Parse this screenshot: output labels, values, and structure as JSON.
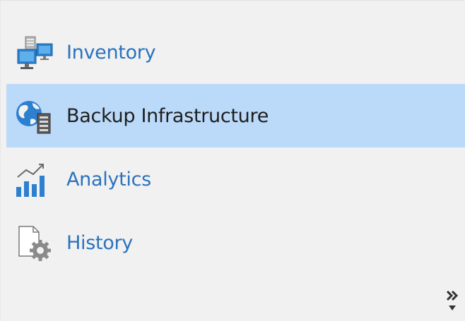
{
  "nav": {
    "items": [
      {
        "label": "Inventory",
        "icon": "inventory-icon",
        "selected": false
      },
      {
        "label": "Backup Infrastructure",
        "icon": "backup-infrastructure-icon",
        "selected": true
      },
      {
        "label": "Analytics",
        "icon": "analytics-icon",
        "selected": false
      },
      {
        "label": "History",
        "icon": "history-icon",
        "selected": false
      }
    ],
    "more_icon": "chevron-double-right-icon",
    "colors": {
      "panel_background": "#f1f1f1",
      "selected_background": "#bbd9f8",
      "link_text": "#2b72bd",
      "selected_text": "#1e1e1e"
    }
  }
}
